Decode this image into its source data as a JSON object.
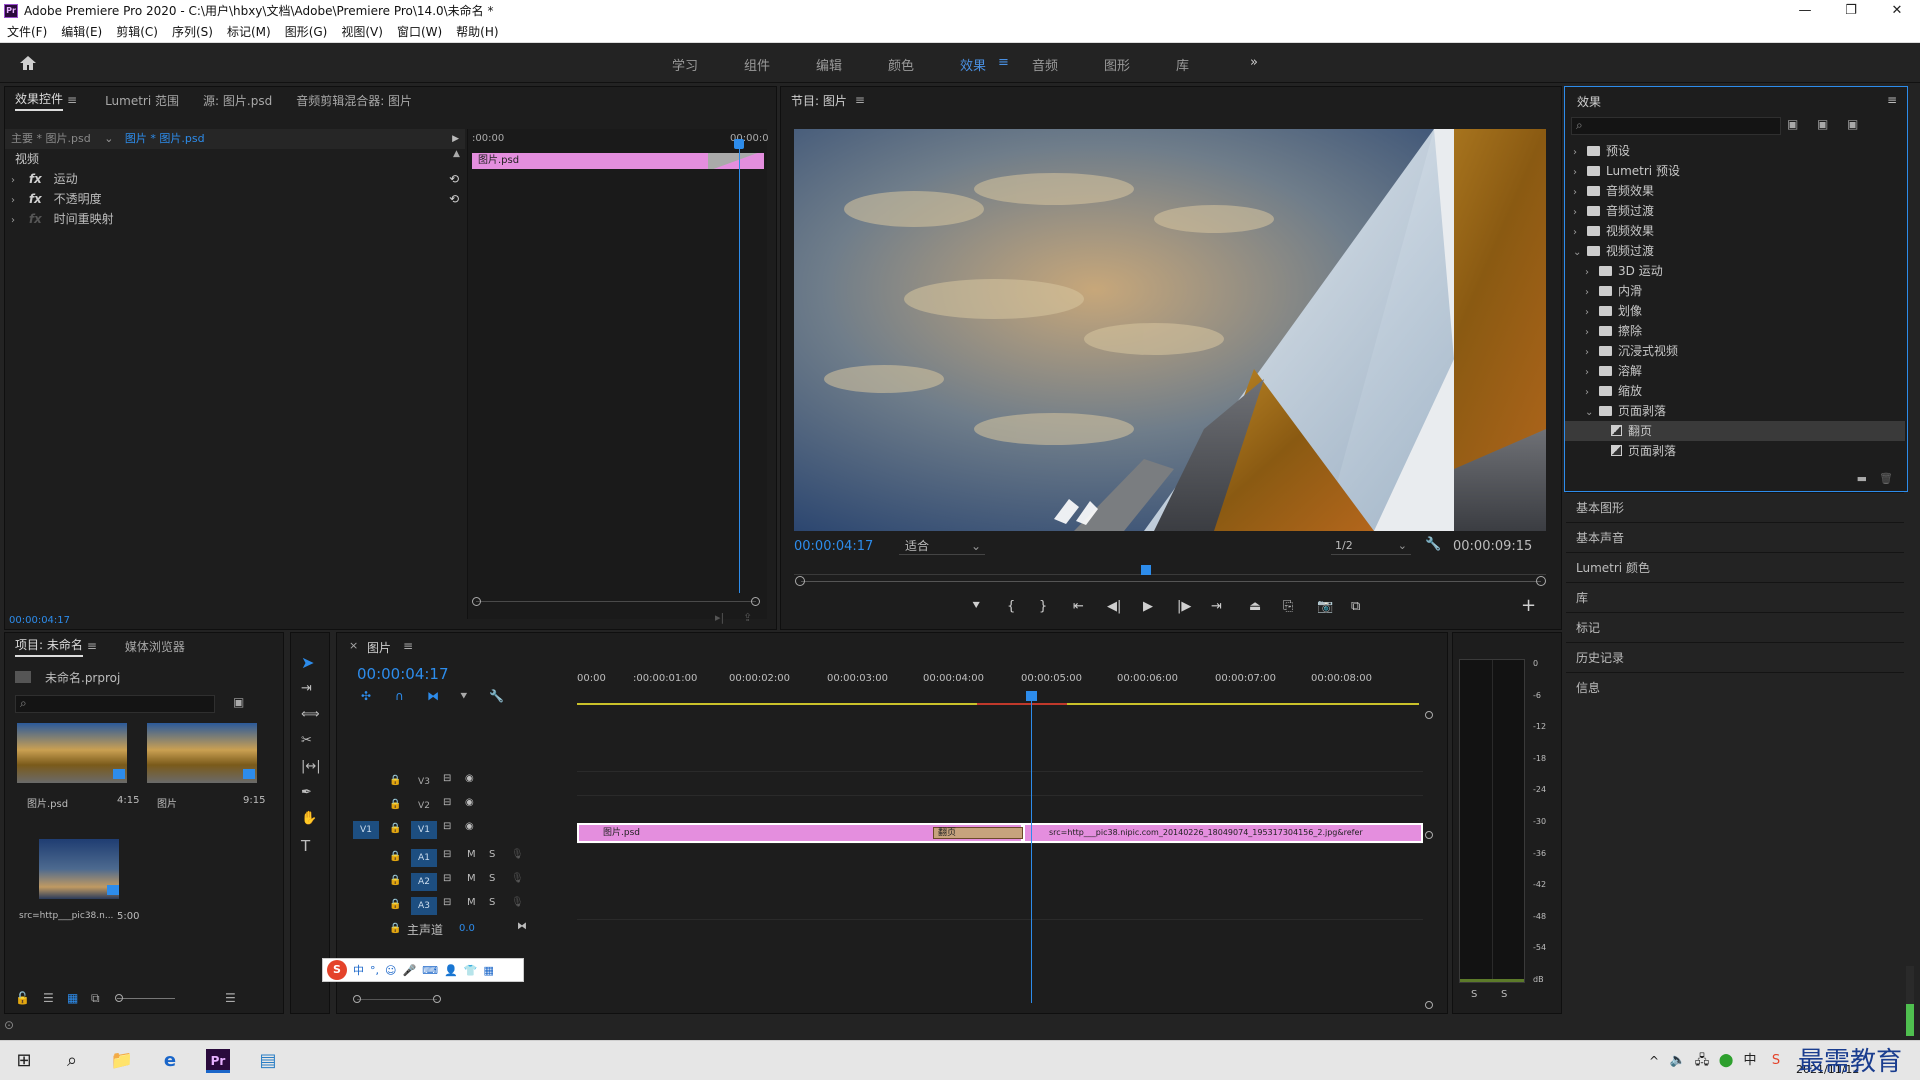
{
  "window": {
    "title": "Adobe Premiere Pro 2020 - C:\\用户\\hbxy\\文档\\Adobe\\Premiere Pro\\14.0\\未命名 *",
    "logo": "Pr"
  },
  "menu": [
    "文件(F)",
    "编辑(E)",
    "剪辑(C)",
    "序列(S)",
    "标记(M)",
    "图形(G)",
    "视图(V)",
    "窗口(W)",
    "帮助(H)"
  ],
  "workspaces": {
    "items": [
      "学习",
      "组件",
      "编辑",
      "颜色",
      "效果",
      "音频",
      "图形",
      "库"
    ],
    "active": "效果",
    "more": "»"
  },
  "effect_controls": {
    "tabs": [
      "效果控件",
      "Lumetri 范围",
      "源: 图片.psd",
      "音频剪辑混合器: 图片"
    ],
    "master_label": "主要 * 图片.psd",
    "clip_label": "图片 * 图片.psd",
    "section_video": "视频",
    "fx_items": [
      "运动",
      "不透明度",
      "时间重映射"
    ],
    "ruler_start": ":00:00",
    "ruler_end": "00:00:0",
    "clip_name": "图片.psd",
    "timecode": "00:00:04:17"
  },
  "program_monitor": {
    "title": "节目: 图片",
    "timecode": "00:00:04:17",
    "fit": "适合",
    "resolution": "1/2",
    "duration": "00:00:09:15"
  },
  "effects_panel": {
    "title": "效果",
    "tree": [
      {
        "label": "预设",
        "depth": 0,
        "open": false
      },
      {
        "label": "Lumetri 预设",
        "depth": 0,
        "open": false
      },
      {
        "label": "音频效果",
        "depth": 0,
        "open": false
      },
      {
        "label": "音频过渡",
        "depth": 0,
        "open": false
      },
      {
        "label": "视频效果",
        "depth": 0,
        "open": false
      },
      {
        "label": "视频过渡",
        "depth": 0,
        "open": true
      },
      {
        "label": "3D 运动",
        "depth": 1,
        "open": false
      },
      {
        "label": "内滑",
        "depth": 1,
        "open": false
      },
      {
        "label": "划像",
        "depth": 1,
        "open": false
      },
      {
        "label": "擦除",
        "depth": 1,
        "open": false
      },
      {
        "label": "沉浸式视频",
        "depth": 1,
        "open": false
      },
      {
        "label": "溶解",
        "depth": 1,
        "open": false
      },
      {
        "label": "缩放",
        "depth": 1,
        "open": false
      },
      {
        "label": "页面剥落",
        "depth": 1,
        "open": true
      },
      {
        "label": "翻页",
        "depth": 2,
        "selected": true
      },
      {
        "label": "页面剥落",
        "depth": 2
      }
    ],
    "side_panels": [
      "基本图形",
      "基本声音",
      "Lumetri 颜色",
      "库",
      "标记",
      "历史记录",
      "信息"
    ]
  },
  "project": {
    "tabs": [
      "项目: 未命名",
      "媒体浏览器"
    ],
    "project_file": "未命名.prproj",
    "items": [
      {
        "name": "图片.psd",
        "duration": "4:15"
      },
      {
        "name": "图片",
        "duration": "9:15"
      },
      {
        "name": "src=http___pic38.n...",
        "duration": "5:00"
      }
    ]
  },
  "timeline": {
    "tab": "图片",
    "timecode": "00:00:04:17",
    "ruler": [
      "00:00",
      ":00:00:01:00",
      "00:00:02:00",
      "00:00:03:00",
      "00:00:04:00",
      "00:00:05:00",
      "00:00:06:00",
      "00:00:07:00",
      "00:00:08:00"
    ],
    "video_tracks": [
      "V3",
      "V2",
      "V1"
    ],
    "audio_tracks": [
      "A1",
      "A2",
      "A3"
    ],
    "source_patch": "V1",
    "master_label": "主声道",
    "master_value": "0.0",
    "clip1": "图片.psd",
    "transition": "翻页",
    "clip2": "src=http___pic38.nipic.com_20140226_18049074_195317304156_2.jpg&refer",
    "mute": "M",
    "solo": "S"
  },
  "audio_meter": {
    "scale": [
      "0",
      "-6",
      "-12",
      "-18",
      "-24",
      "-30",
      "-36",
      "-42",
      "-48",
      "-54",
      "dB"
    ],
    "solo": [
      "S",
      "S"
    ]
  },
  "taskbar": {
    "time": "",
    "date": "2021/11/12",
    "watermark": "最需教育"
  }
}
